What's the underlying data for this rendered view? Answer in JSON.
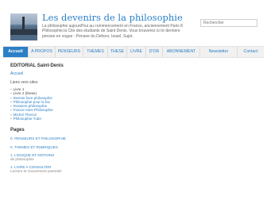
{
  "header": {
    "title": "Les devenirs de la philosophie",
    "description": "La philosophie aujourd'hui au commencement en France, anciennement Paris 8 Philosophie.la Cite des etudiants de Saint Denis. Vous trouverez ici le derniere pensee en vogue - Pensee du Dehors, Israel, Sujet.",
    "search_placeholder": "Rechercher"
  },
  "nav": {
    "items": [
      {
        "label": "Accueil",
        "active": true
      },
      {
        "label": "A PROPOS"
      },
      {
        "label": "PENSEURS"
      },
      {
        "label": "THEMES"
      },
      {
        "label": "THESE"
      },
      {
        "label": "LIVRE"
      },
      {
        "label": "D'OR"
      },
      {
        "label": "ABONNEMENT"
      },
      {
        "label": "Newsletter"
      },
      {
        "label": "Contact"
      }
    ]
  },
  "sidebar": {
    "editorial_title": "EDITORIAL Saint-Denis",
    "home_link": "Accueil",
    "links_intro": "Liens vers sites",
    "links": [
      "Livre 1",
      "Livre 2 (these)",
      "Dernier livre philosophie",
      "Philosophie pour la fac",
      "Dossiers philosophie",
      "France Inter-Philosophie",
      "Michel Thevoz",
      "Philosophie Tube"
    ],
    "pages_title": "Pages",
    "pages": [
      {
        "main": "0. PENSEURS ET PHILOSOPHIE"
      },
      {
        "main": "0. THEMES ET RUBRIQUES"
      },
      {
        "main": "1. LOGIQUE ET NOTIONS",
        "sub": "de philosophie"
      },
      {
        "main": "1. LIVRE A CONSULTER",
        "sub": "Lecture et mouvement potentiel"
      }
    ]
  }
}
